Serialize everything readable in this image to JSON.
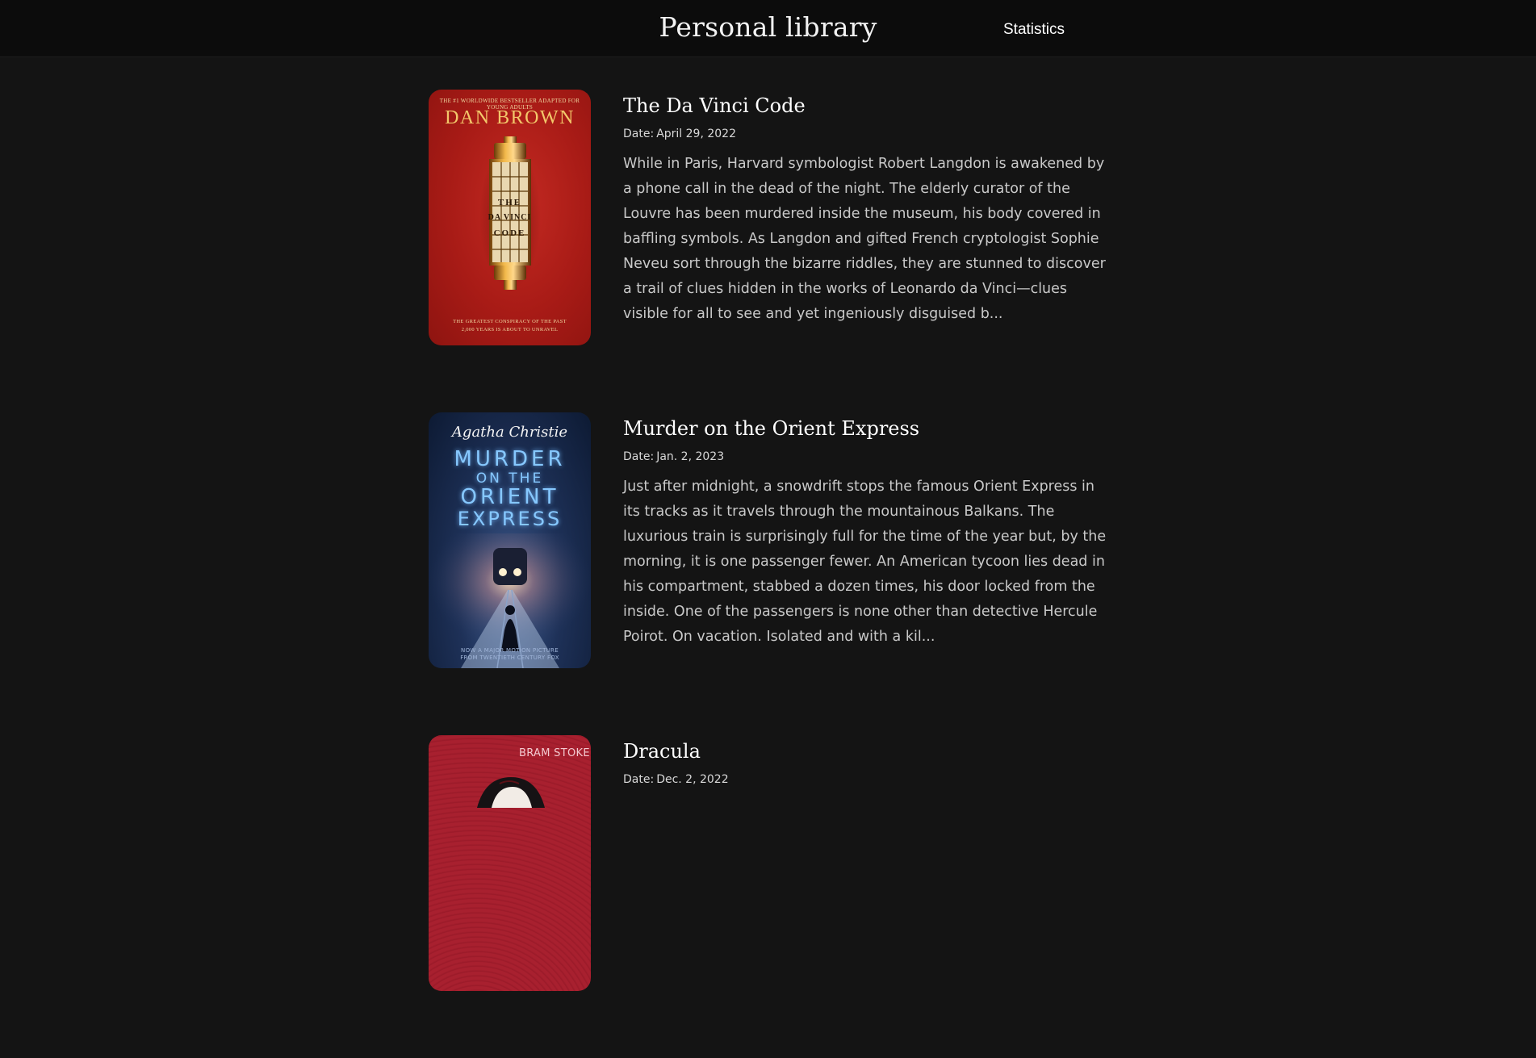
{
  "header": {
    "title": "Personal library",
    "nav": {
      "statistics": "Statistics"
    }
  },
  "date_label": "Date:",
  "books": [
    {
      "title": "The Da Vinci Code",
      "date": "April 29, 2022",
      "description": "While in Paris, Harvard symbologist Robert Langdon is awakened by a phone call in the dead of the night. The elderly curator of the Louvre has been murdered inside the museum, his body covered in baffling symbols. As Langdon and gifted French cryptologist Sophie Neveu sort through the bizarre riddles, they are stunned to discover a trail of clues hidden in the works of Leonardo da Vinci—clues visible for all to see and yet ingeniously disguised b...",
      "cover": {
        "top_text": "THE #1 WORLDWIDE BESTSELLER ADAPTED FOR YOUNG ADULTS",
        "author": "DAN BROWN",
        "cryptex_words": [
          "THE",
          "DA VINCI",
          "CODE"
        ],
        "bottom_text_1": "THE GREATEST CONSPIRACY OF THE PAST",
        "bottom_text_2": "2,000 YEARS IS ABOUT TO UNRAVEL"
      }
    },
    {
      "title": "Murder on the Orient Express",
      "date": "Jan. 2, 2023",
      "description": "Just after midnight, a snowdrift stops the famous Orient Express in its tracks as it travels through the mountainous Balkans. The luxurious train is surprisingly full for the time of the year but, by the morning, it is one passenger fewer. An American tycoon lies dead in his compartment, stabbed a dozen times, his door locked from the inside. One of the passengers is none other than detective Hercule Poirot. On vacation. Isolated and with a kil...",
      "cover": {
        "author": "Agatha Christie",
        "title_l1": "MURDER",
        "title_l2": "ON THE",
        "title_l3": "ORIENT",
        "title_l4": "EXPRESS",
        "bottom_text_1": "NOW A MAJOR MOTION PICTURE",
        "bottom_text_2": "FROM TWENTIETH CENTURY FOX"
      }
    },
    {
      "title": "Dracula",
      "date": "Dec. 2, 2022",
      "cover": {
        "author": "BRAM STOKER"
      }
    }
  ],
  "colors": {
    "background": "#141414",
    "header_bg": "#0c0c0c",
    "davinci_red": "#a81b16",
    "orient_blue": "#1e3158",
    "dracula_red": "#a8202f"
  }
}
